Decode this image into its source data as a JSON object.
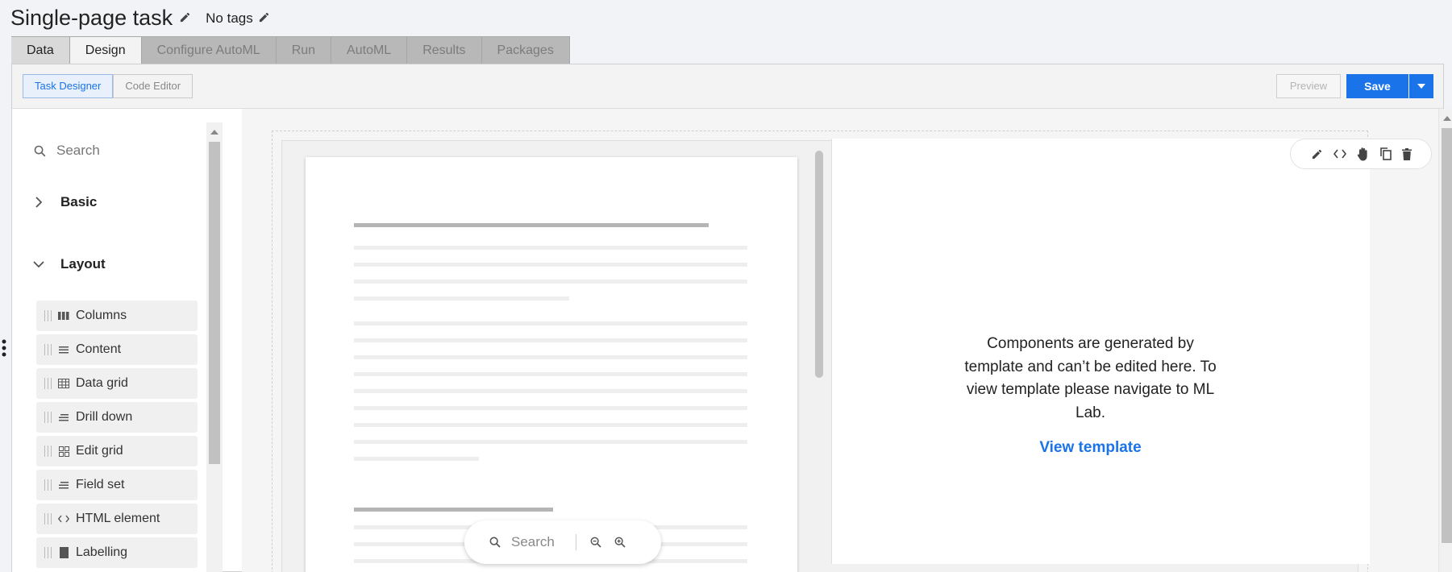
{
  "header": {
    "title": "Single-page task",
    "tags": "No tags"
  },
  "tabs": [
    "Data",
    "Design",
    "Configure AutoML",
    "Run",
    "AutoML",
    "Results",
    "Packages"
  ],
  "toolbar": {
    "task_designer": "Task Designer",
    "code_editor": "Code Editor",
    "preview": "Preview",
    "save": "Save"
  },
  "sidebar": {
    "search_placeholder": "Search",
    "groups": [
      "Basic",
      "Layout"
    ],
    "items": [
      {
        "label": "Columns",
        "icon": "columns-icon"
      },
      {
        "label": "Content",
        "icon": "content-icon"
      },
      {
        "label": "Data grid",
        "icon": "data-grid-icon"
      },
      {
        "label": "Drill down",
        "icon": "drill-down-icon"
      },
      {
        "label": "Edit grid",
        "icon": "edit-grid-icon"
      },
      {
        "label": "Field set",
        "icon": "field-set-icon"
      },
      {
        "label": "HTML element",
        "icon": "code-icon"
      },
      {
        "label": "Labelling",
        "icon": "labelling-icon"
      }
    ]
  },
  "viewer": {
    "search": "Search"
  },
  "component": {
    "message": "Components are generated by template and can’t be edited here. To view template please navigate to ML Lab.",
    "link": "View template"
  },
  "colors": {
    "accent": "#1a73e8"
  }
}
